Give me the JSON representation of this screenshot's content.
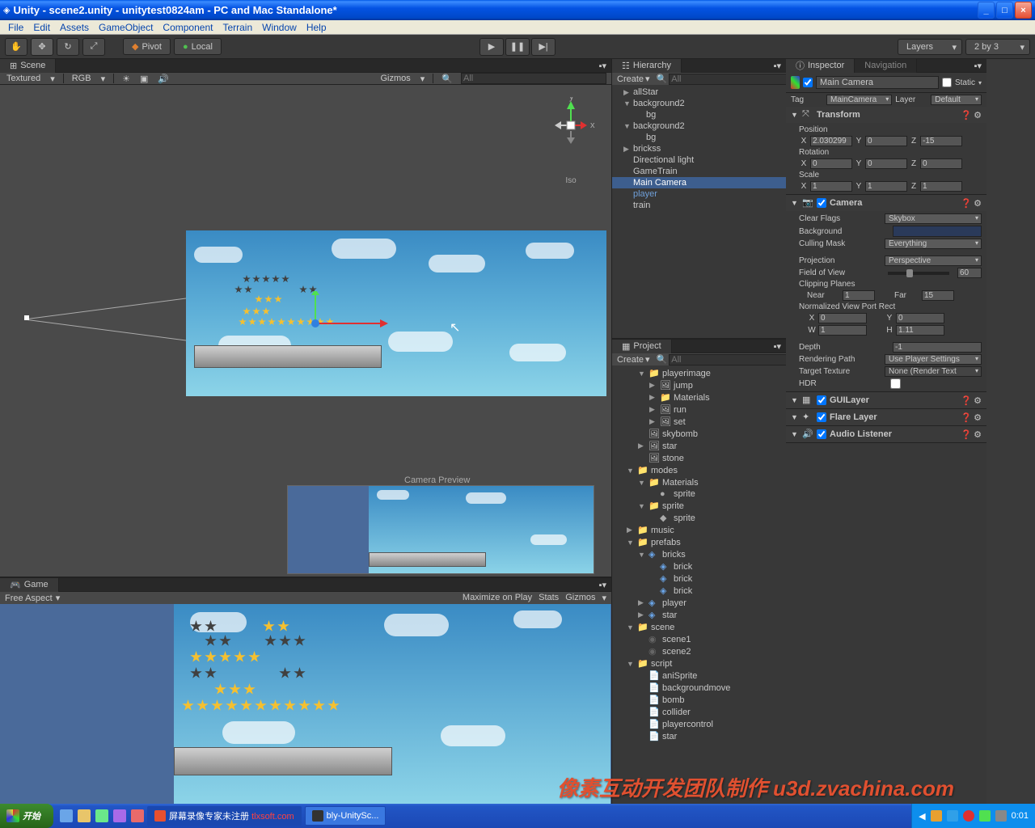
{
  "window": {
    "title": "Unity - scene2.unity - unitytest0824am - PC and Mac Standalone*"
  },
  "menu": {
    "file": "File",
    "edit": "Edit",
    "assets": "Assets",
    "gameobject": "GameObject",
    "component": "Component",
    "terrain": "Terrain",
    "window": "Window",
    "help": "Help"
  },
  "toolbar": {
    "pivot": "Pivot",
    "local": "Local",
    "layers": "Layers",
    "layout": "2 by 3"
  },
  "scene": {
    "tab": "Scene",
    "textured": "Textured",
    "rgb": "RGB",
    "gizmos": "Gizmos",
    "search_ph": "All",
    "iso": "Iso",
    "axis_x": "x",
    "axis_y": "y",
    "camera_preview": "Camera Preview"
  },
  "game": {
    "tab": "Game",
    "free_aspect": "Free Aspect",
    "maximize": "Maximize on Play",
    "stats": "Stats",
    "gizmos": "Gizmos"
  },
  "hierarchy": {
    "tab": "Hierarchy",
    "create": "Create",
    "search_ph": "All",
    "items": [
      {
        "name": "allStar",
        "expandable": true
      },
      {
        "name": "background2",
        "expandable": true,
        "expanded": true
      },
      {
        "name": "bg",
        "child": true
      },
      {
        "name": "background2",
        "expandable": true,
        "expanded": true
      },
      {
        "name": "bg",
        "child": true
      },
      {
        "name": "brickss",
        "expandable": true
      },
      {
        "name": "Directional light"
      },
      {
        "name": "GameTrain"
      },
      {
        "name": "Main Camera",
        "selected": true
      },
      {
        "name": "player",
        "special": true
      },
      {
        "name": "train"
      }
    ]
  },
  "project": {
    "tab": "Project",
    "create": "Create",
    "search_ph": "All",
    "items": [
      {
        "name": "playerimage",
        "type": "folder",
        "indent": 2,
        "arrow": "down"
      },
      {
        "name": "jump",
        "type": "image",
        "indent": 3,
        "arrow": "right"
      },
      {
        "name": "Materials",
        "type": "folder",
        "indent": 3,
        "arrow": "right"
      },
      {
        "name": "run",
        "type": "image",
        "indent": 3,
        "arrow": "right"
      },
      {
        "name": "set",
        "type": "image",
        "indent": 3,
        "arrow": "right"
      },
      {
        "name": "skybomb",
        "type": "image",
        "indent": 2
      },
      {
        "name": "star",
        "type": "image",
        "indent": 2,
        "arrow": "right"
      },
      {
        "name": "stone",
        "type": "image",
        "indent": 2
      },
      {
        "name": "modes",
        "type": "folder",
        "indent": 1,
        "arrow": "down"
      },
      {
        "name": "Materials",
        "type": "folder",
        "indent": 2,
        "arrow": "down"
      },
      {
        "name": "sprite",
        "type": "material",
        "indent": 3
      },
      {
        "name": "sprite",
        "type": "folder",
        "indent": 2,
        "arrow": "down"
      },
      {
        "name": "sprite",
        "type": "mesh",
        "indent": 3
      },
      {
        "name": "music",
        "type": "folder",
        "indent": 1,
        "arrow": "right"
      },
      {
        "name": "prefabs",
        "type": "folder",
        "indent": 1,
        "arrow": "down"
      },
      {
        "name": "bricks",
        "type": "prefab",
        "indent": 2,
        "arrow": "down"
      },
      {
        "name": "brick",
        "type": "prefab",
        "indent": 3
      },
      {
        "name": "brick",
        "type": "prefab",
        "indent": 3
      },
      {
        "name": "brick",
        "type": "prefab",
        "indent": 3
      },
      {
        "name": "player",
        "type": "prefab",
        "indent": 2,
        "arrow": "right"
      },
      {
        "name": "star",
        "type": "prefab",
        "indent": 2,
        "arrow": "right"
      },
      {
        "name": "scene",
        "type": "folder",
        "indent": 1,
        "arrow": "down"
      },
      {
        "name": "scene1",
        "type": "scene",
        "indent": 2
      },
      {
        "name": "scene2",
        "type": "scene",
        "indent": 2
      },
      {
        "name": "script",
        "type": "folder",
        "indent": 1,
        "arrow": "down"
      },
      {
        "name": "aniSprite",
        "type": "script",
        "indent": 2
      },
      {
        "name": "backgroundmove",
        "type": "script",
        "indent": 2
      },
      {
        "name": "bomb",
        "type": "script",
        "indent": 2
      },
      {
        "name": "collider",
        "type": "script",
        "indent": 2
      },
      {
        "name": "playercontrol",
        "type": "script",
        "indent": 2
      },
      {
        "name": "star",
        "type": "script",
        "indent": 2
      }
    ]
  },
  "inspector": {
    "tab": "Inspector",
    "nav_tab": "Navigation",
    "object_name": "Main Camera",
    "static": "Static",
    "tag_label": "Tag",
    "tag_value": "MainCamera",
    "layer_label": "Layer",
    "layer_value": "Default",
    "transform": {
      "title": "Transform",
      "position": "Position",
      "rotation": "Rotation",
      "scale": "Scale",
      "pos_x": "2.030299",
      "pos_y": "0",
      "pos_z": "-15",
      "rot_x": "0",
      "rot_y": "0",
      "rot_z": "0",
      "scl_x": "1",
      "scl_y": "1",
      "scl_z": "1"
    },
    "camera": {
      "title": "Camera",
      "clear_flags_l": "Clear Flags",
      "clear_flags_v": "Skybox",
      "background_l": "Background",
      "culling_l": "Culling Mask",
      "culling_v": "Everything",
      "projection_l": "Projection",
      "projection_v": "Perspective",
      "fov_l": "Field of View",
      "fov_v": "60",
      "clip_l": "Clipping Planes",
      "near_l": "Near",
      "near_v": "1",
      "far_l": "Far",
      "far_v": "15",
      "viewport_l": "Normalized View Port Rect",
      "vp_x": "0",
      "vp_y": "0",
      "vp_w": "1",
      "vp_h": "1.11",
      "depth_l": "Depth",
      "depth_v": "-1",
      "rpath_l": "Rendering Path",
      "rpath_v": "Use Player Settings",
      "ttex_l": "Target Texture",
      "ttex_v": "None (Render Text",
      "hdr_l": "HDR"
    },
    "guilayer": "GUILayer",
    "flarelayer": "Flare Layer",
    "audiolistener": "Audio Listener"
  },
  "taskbar": {
    "start": "开始",
    "task1": "屏幕录像专家未注册",
    "task1_suffix": "tlxsoft.com",
    "task2": "bly-UnitySc...",
    "time": "0:01"
  },
  "watermark": "像素互动开发团队制作  u3d.zvachina.com"
}
